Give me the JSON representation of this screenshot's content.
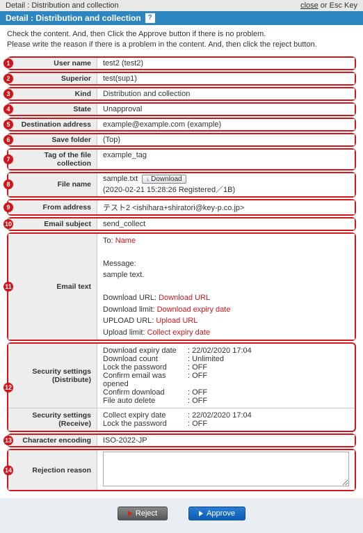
{
  "topbar": {
    "prefix": "Detail :",
    "title": "Distribution and collection",
    "close": "close",
    "or": " or Esc Key"
  },
  "bluebar": {
    "prefix": "Detail :",
    "title": "Distribution and collection",
    "help": "?"
  },
  "instructions": {
    "line1": "Check the content. And, then Click the Approve button if there is no problem.",
    "line2": "Please write the reason if there is a problem in the content. And, then click the reject button."
  },
  "rows": {
    "r1": {
      "n": "1",
      "label": "User name",
      "value": "test2 (test2)"
    },
    "r2": {
      "n": "2",
      "label": "Superior",
      "value": "test(sup1)"
    },
    "r3": {
      "n": "3",
      "label": "Kind",
      "value": "Distribution and collection"
    },
    "r4": {
      "n": "4",
      "label": "State",
      "value": "Unapproval"
    },
    "r5": {
      "n": "5",
      "label": "Destination address",
      "value": "example@example.com (example)"
    },
    "r6": {
      "n": "6",
      "label": "Save folder",
      "value": "(Top)"
    },
    "r7": {
      "n": "7",
      "label": "Tag of the file collection",
      "value": "example_tag"
    },
    "r8": {
      "n": "8",
      "label": "File name",
      "file": "sample.txt",
      "download": "Download",
      "meta": "(2020-02-21 15:28:26 Registered／1B)"
    },
    "r9": {
      "n": "9",
      "label": "From address",
      "value": "テスト2 <ishihara+shiratori@key-p.co.jp>"
    },
    "r10": {
      "n": "10",
      "label": "Email subject",
      "value": "send_collect"
    },
    "r11": {
      "n": "11",
      "label": "Email text",
      "to_label": "To:",
      "to_value": "Name",
      "msg_label": "Message:",
      "msg_value": "sample text.",
      "dl_url_l": "Download URL:",
      "dl_url_v": "Download URL",
      "dl_lim_l": "Download limit:",
      "dl_lim_v": "Download expiry date",
      "up_url_l": "UPLOAD URL:",
      "up_url_v": "Upload URL",
      "up_lim_l": "Upload limit:",
      "up_lim_v": "Collect expiry date"
    },
    "r12": {
      "n": "12",
      "dist_label1": "Security settings",
      "dist_label2": "(Distribute)",
      "dist": {
        "a": {
          "k": "Download expiry date",
          "v": ": 22/02/2020 17:04"
        },
        "b": {
          "k": "Download count",
          "v": ": Unlimited"
        },
        "c": {
          "k": "Lock the password",
          "v": ": OFF"
        },
        "d": {
          "k": "Confirm email was opened",
          "v": ": OFF"
        },
        "e": {
          "k": "Confirm download",
          "v": ": OFF"
        },
        "f": {
          "k": "File auto delete",
          "v": ": OFF"
        }
      },
      "recv_label1": "Security settings",
      "recv_label2": "(Receive)",
      "recv": {
        "a": {
          "k": "Collect expiry date",
          "v": ": 22/02/2020 17:04"
        },
        "b": {
          "k": "Lock the password",
          "v": ": OFF"
        }
      }
    },
    "r13": {
      "n": "13",
      "label": "Character encoding",
      "value": "ISO-2022-JP"
    },
    "r14": {
      "n": "14",
      "label": "Rejection reason",
      "value": ""
    }
  },
  "buttons": {
    "reject": "Reject",
    "approve": "Approve"
  }
}
